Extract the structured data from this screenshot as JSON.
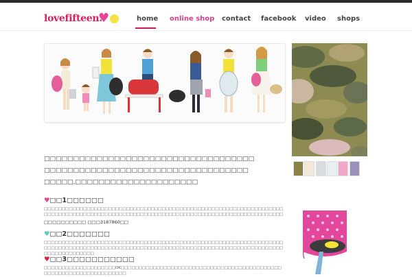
{
  "brand": {
    "name": "lovefifteen."
  },
  "nav": [
    {
      "label": "home"
    },
    {
      "label": "online shop"
    },
    {
      "label": "contact"
    },
    {
      "label": "facebook"
    },
    {
      "label": "video"
    },
    {
      "label": "shops"
    }
  ],
  "intro": {
    "lines": [
      "□□□□□□□□□□□□□□□□□□□□□□□□□□□□□□□□□□□□",
      "□□□□□□□□□□□□□□□□□□□□□□□□□□□□□□□□□□□",
      "□□□□□,□□□□□□□□□□□□□□□□□□□□□"
    ]
  },
  "sections": [
    {
      "title": "□□1□□□□□□",
      "body": "□□□□□□□□□□□□□□□□□□□□□□□□□□□□□□□□□□□□□□□□□□□□□□□□□□□□□□□□□□□□□□□□□□□□□□□□□□□□□□□□□□□□□□□□□□□□□□□□□□□□□□□□□□□□□□□□□□□□□□□□□□□□□□□□□□□□□□",
      "tel": "□□□□□□□□□□ □□□3187860□□"
    },
    {
      "title": "□□2□□□□□□□",
      "body": "□□□□□□□□□□□□□□□□□□□□□□□□□□□□□□□□□□□□□□□□□□□□□□□□□□□□□□□□□□□□□□□□□□□□□□□□□□□□□□□□□□□□□□□□□□□□□□□□□□□□□□□□□□□□□□□□□□□□□□□□□□□□□□□□□□□□□□□□□□□□□□□□□□□□"
    },
    {
      "title": "□□3□□□□□□□□□□□",
      "body": "□□□□□□□□□□□□□□□□□□□□OK□□□□□□□□□□□□□□□□□□□□□□□□□□□□□□□□□□□□□□□□□□□□□□□□□□□□□□□□□□□□□□□□□□□□"
    }
  ],
  "thumbnails": [
    {
      "color": "#8a8244"
    },
    {
      "color": "#f3e7dc"
    },
    {
      "color": "#d8dbe0"
    },
    {
      "color": "#e8eef2"
    },
    {
      "color": "#f2a8c8"
    },
    {
      "color": "#9a90b8"
    }
  ],
  "colors": {
    "accent": "#c8175a",
    "pink": "#d0438a",
    "heart_pink": "#e0458f",
    "heart_blue": "#5ec5c9",
    "heart_red": "#d6243c"
  }
}
